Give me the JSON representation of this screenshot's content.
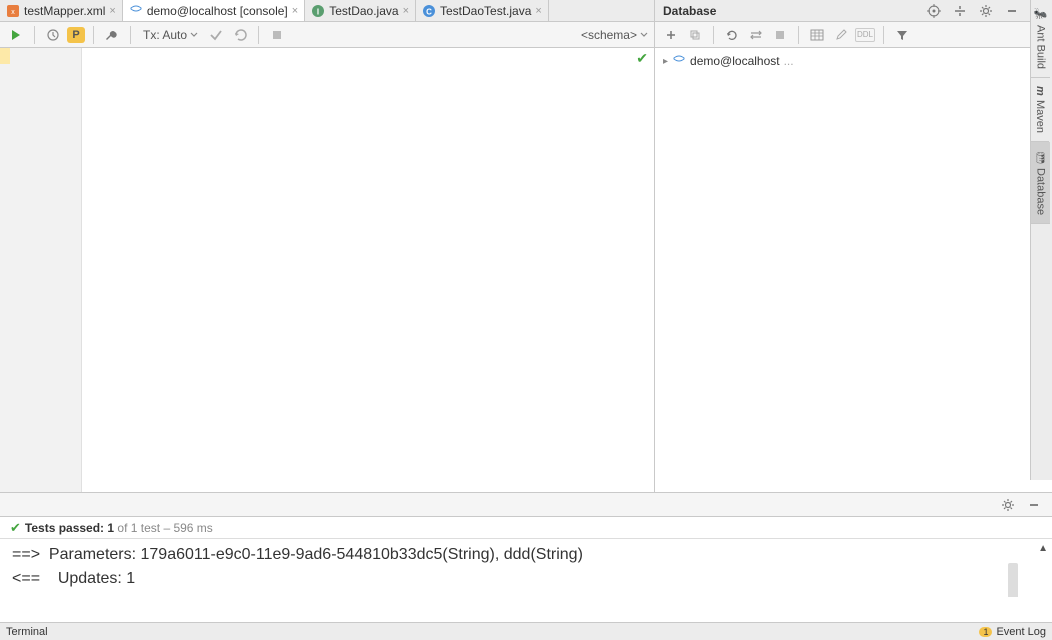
{
  "tabs": [
    {
      "label": "testMapper.xml",
      "icon": "xml"
    },
    {
      "label": "demo@localhost [console]",
      "icon": "db"
    },
    {
      "label": "TestDao.java",
      "icon": "interface"
    },
    {
      "label": "TestDaoTest.java",
      "icon": "class"
    }
  ],
  "toolbar": {
    "tx_label": "Tx: Auto",
    "schema_label": "<schema>"
  },
  "db": {
    "title": "Database",
    "root": "demo@localhost",
    "root_suffix": "..."
  },
  "side": {
    "ant": "Ant Build",
    "maven": "Maven",
    "database": "Database"
  },
  "tests": {
    "prefix": "Tests passed: ",
    "passed": "1",
    "mid": " of 1 test – ",
    "time": "596 ms"
  },
  "console": {
    "line1": "==>  Parameters: 179a6011-e9c0-11e9-9ad6-544810b33dc5(String), ddd(String)",
    "line2": "<==    Updates: 1"
  },
  "status": {
    "terminal": "Terminal",
    "event_log": "Event Log",
    "badge": "1"
  }
}
